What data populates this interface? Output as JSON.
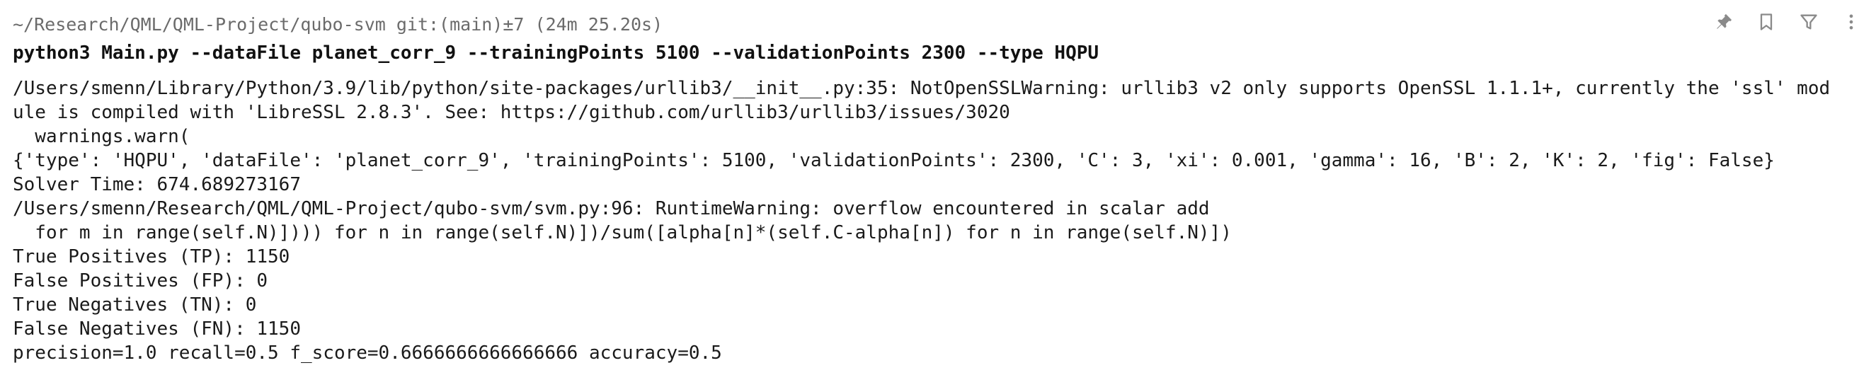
{
  "prompt": {
    "text": "~/Research/QML/QML-Project/qubo-svm git:(main)±7 (24m 25.20s)"
  },
  "command": {
    "text": "python3 Main.py --dataFile planet_corr_9 --trainingPoints 5100 --validationPoints 2300 --type HQPU"
  },
  "output_lines": [
    "/Users/smenn/Library/Python/3.9/lib/python/site-packages/urllib3/__init__.py:35: NotOpenSSLWarning: urllib3 v2 only supports OpenSSL 1.1.1+, currently the 'ssl' mod",
    "ule is compiled with 'LibreSSL 2.8.3'. See: https://github.com/urllib3/urllib3/issues/3020",
    "  warnings.warn(",
    "{'type': 'HQPU', 'dataFile': 'planet_corr_9', 'trainingPoints': 5100, 'validationPoints': 2300, 'C': 3, 'xi': 0.001, 'gamma': 16, 'B': 2, 'K': 2, 'fig': False}",
    "Solver Time: 674.689273167",
    "/Users/smenn/Research/QML/QML-Project/qubo-svm/svm.py:96: RuntimeWarning: overflow encountered in scalar add",
    "  for m in range(self.N)]))) for n in range(self.N)])/sum([alpha[n]*(self.C-alpha[n]) for n in range(self.N)])",
    "True Positives (TP): 1150",
    "False Positives (FP): 0",
    "True Negatives (TN): 0",
    "False Negatives (FN): 1150",
    "precision=1.0 recall=0.5 f_score=0.6666666666666666 accuracy=0.5"
  ],
  "toolbar": {
    "icons": [
      "pin-icon",
      "bookmark-icon",
      "filter-icon",
      "more-vertical-icon"
    ],
    "icon_color": "#8a8a8a"
  }
}
